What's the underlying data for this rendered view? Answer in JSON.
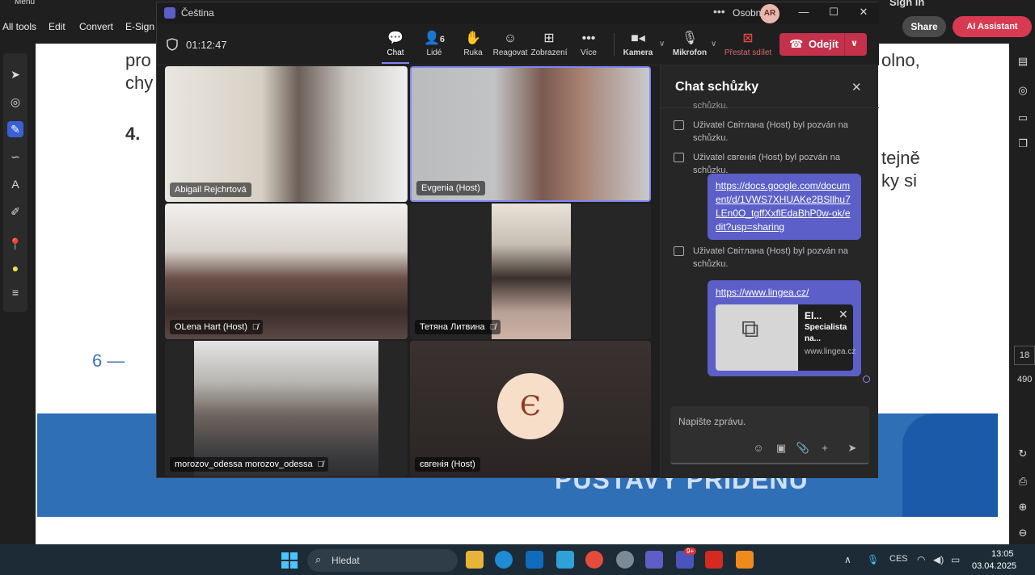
{
  "acrobat": {
    "menu_label": "Menu",
    "sign_in": "Sign in",
    "toolbar": [
      "All tools",
      "Edit",
      "Convert",
      "E-Sign"
    ],
    "share": "Share",
    "ai_assistant": "AI Assistant",
    "page_number": "18",
    "page_total": "490",
    "doc_text_1": "pro",
    "doc_text_2": "chy",
    "doc_text_3": "4.",
    "doc_text_4": "olno,",
    "doc_text_5": "tejně",
    "doc_text_6": "ky si",
    "doc_page_footer": "6 —",
    "banner_text": "PŮSTAVY PŘIDENU"
  },
  "teams": {
    "window_title": "Čeština",
    "profile_label": "Osobní",
    "avatar_initials": "AR",
    "timer": "01:12:47",
    "buttons": {
      "chat": "Chat",
      "people": "Lidé",
      "people_count": "6",
      "raise": "Ruka",
      "react": "Reagovat",
      "view": "Zobrazení",
      "more": "Více",
      "camera": "Kamera",
      "mic": "Mikrofon",
      "stop_share": "Přestat sdílet",
      "leave": "Odejít"
    },
    "participants": [
      {
        "name": "Abigail Rejchrtová",
        "muted": false
      },
      {
        "name": "Evgenia (Host)",
        "muted": false
      },
      {
        "name": "OLena Hart (Host)",
        "muted": true
      },
      {
        "name": "Тетяна Литвина",
        "muted": true
      },
      {
        "name": "morozov_odessa morozov_odessa",
        "muted": true
      },
      {
        "name": "євгенія (Host)",
        "muted": false,
        "initial": "Є"
      }
    ],
    "chat": {
      "title": "Chat schůzky",
      "sys_partial": "schůzku.",
      "sys_1": "Uživatel Світлана (Host) byl pozván na schůzku.",
      "sys_2": "Uživatel євгенія (Host) byl pozván na schůzku.",
      "link_1": "https://docs.google.com/document/d/1VWS7XHUAKe2BSllhu7LEn0O_tgffXxflEdaBhP0w-ok/edit?usp=sharing",
      "sys_3": "Uživatel Світлана (Host) byl pozván na schůzku.",
      "link_2": "https://www.lingea.cz/",
      "preview_title": "El...",
      "preview_desc": "Specialista na...",
      "preview_url": "www.lingea.cz",
      "compose_placeholder": "Napište zprávu."
    }
  },
  "taskbar": {
    "search": "Hledat",
    "language": "CES",
    "time": "13:05",
    "date": "03.04.2025",
    "teams_badge": "9+"
  }
}
